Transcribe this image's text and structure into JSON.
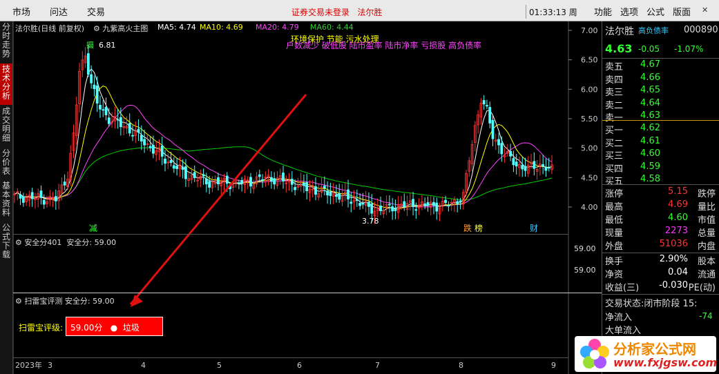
{
  "topbar": {
    "menu": [
      "市场",
      "问达",
      "交易"
    ],
    "notice": "证券交易未登录",
    "stock_name_top": "法尔胜",
    "time": "01:33:13",
    "weekday": "周一",
    "right_menu": [
      "功能",
      "选项",
      "公式",
      "版面"
    ]
  },
  "sidebar": {
    "tabs": [
      {
        "label": "分时走势",
        "active": false
      },
      {
        "label": "技术分析",
        "active": true
      },
      {
        "label": "成交明细",
        "active": false
      },
      {
        "label": "分价表",
        "active": false
      },
      {
        "label": "基本资料",
        "active": false
      },
      {
        "label": "公式下载",
        "active": false
      }
    ]
  },
  "main_chart": {
    "title": "法尔胜(日线 前复权)",
    "indicator": "九紫高火主图",
    "ma5": "MA5: 4.74",
    "ma10": "MA10: 4.69",
    "ma20": "MA20: 4.79",
    "ma60": "MA60: 4.44",
    "concept_yellow": "环境保护 节能 污水处理",
    "concept_magenta": "户数减少 破低股 陆市盈率 陆市净率 亏损股 高负债率",
    "price_axis": [
      "7.00",
      "6.50",
      "6.00",
      "5.50",
      "5.00",
      "4.50",
      "4.00"
    ],
    "high_label": "6.81",
    "low_label": "3.78",
    "marker_high": "摄",
    "event_markers": [
      "减",
      "跌",
      "榜",
      "财"
    ],
    "x_axis": [
      "2023年",
      "3",
      "4",
      "5",
      "6",
      "7",
      "8",
      "9"
    ]
  },
  "safety_panel": {
    "title": "安全分401",
    "value_label": "安全分: 59.00",
    "axis": [
      "59.00",
      "59.00"
    ]
  },
  "saolei_panel": {
    "title": "扫雷宝评测",
    "value_label": "安全分: 59.00",
    "rating_label": "扫雷宝评级:",
    "rating_value": "59.00分",
    "rating_text": "垃圾"
  },
  "right_panel": {
    "name": "法尔胜",
    "tag": "高负债率",
    "code": "000890",
    "price": "4.63",
    "change": "-0.05",
    "change_pct": "-1.07%",
    "asks": [
      {
        "label": "卖五",
        "price": "4.67"
      },
      {
        "label": "卖四",
        "price": "4.66"
      },
      {
        "label": "卖三",
        "price": "4.65"
      },
      {
        "label": "卖二",
        "price": "4.64"
      },
      {
        "label": "卖一",
        "price": "4.63"
      }
    ],
    "bids": [
      {
        "label": "买一",
        "price": "4.62"
      },
      {
        "label": "买二",
        "price": "4.61"
      },
      {
        "label": "买三",
        "price": "4.60"
      },
      {
        "label": "买四",
        "price": "4.59"
      },
      {
        "label": "买五",
        "price": "4.58"
      }
    ],
    "stats": [
      {
        "label": "涨停",
        "value": "5.15",
        "right": "跌停",
        "color": "#f33"
      },
      {
        "label": "最高",
        "value": "4.69",
        "right": "量比",
        "color": "#f33"
      },
      {
        "label": "最低",
        "value": "4.60",
        "right": "市值",
        "color": "#3f3"
      },
      {
        "label": "现量",
        "value": "2273",
        "right": "总量",
        "color": "#f3f"
      },
      {
        "label": "外盘",
        "value": "51036",
        "right": "内盘",
        "color": "#f33"
      }
    ],
    "stats2": [
      {
        "label": "换手",
        "value": "2.90%",
        "right": "股本",
        "color": "#fff"
      },
      {
        "label": "净资",
        "value": "0.04",
        "right": "流通",
        "color": "#fff"
      },
      {
        "label": "收益(三)",
        "value": "-0.030",
        "right": "PE(动)",
        "color": "#fff"
      }
    ],
    "trade_status_label": "交易状态:",
    "trade_status": "闭市阶段",
    "trade_status_num": "15:",
    "net_inflow_label": "净流入",
    "net_inflow": "-74",
    "big_inflow_label": "大单流入"
  },
  "logo": {
    "text1": "分析家公式网",
    "text2": "www.fxjgsw.com"
  },
  "colors": {
    "up": "#ff3333",
    "down": "#54ffff",
    "ma5": "#ffffff",
    "ma10": "#ffff00",
    "ma20": "#ff44ff",
    "ma60": "#00cc00"
  }
}
